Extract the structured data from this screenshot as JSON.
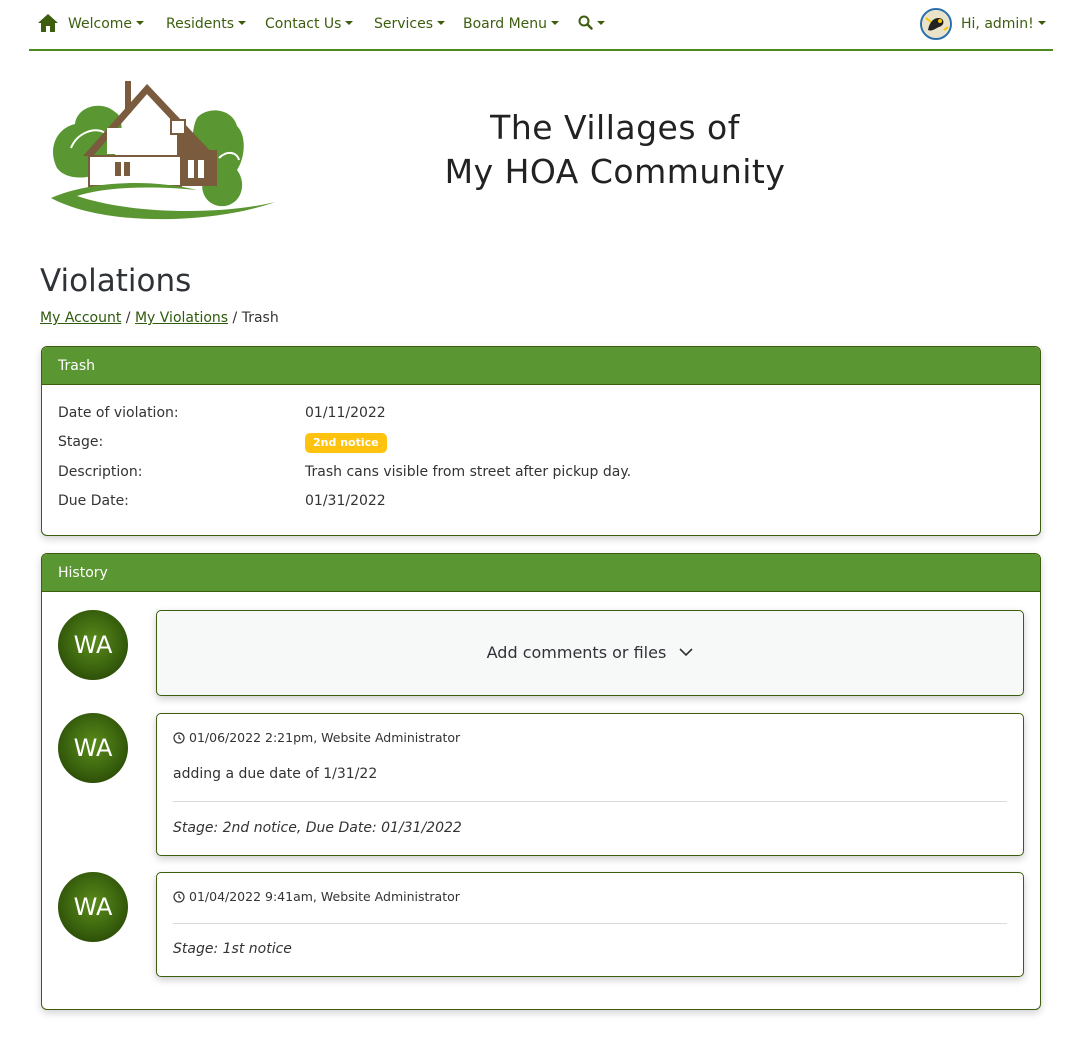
{
  "nav": {
    "items": [
      {
        "label": "Welcome"
      },
      {
        "label": "Residents"
      },
      {
        "label": "Contact Us"
      },
      {
        "label": "Services"
      },
      {
        "label": "Board Menu"
      }
    ],
    "user_greeting": "Hi, admin!"
  },
  "header": {
    "title_line1": "The Villages of",
    "title_line2": "My HOA Community"
  },
  "page": {
    "title": "Violations",
    "breadcrumb": {
      "link1": "My Account",
      "sep1": "/",
      "link2": "My Violations",
      "sep2": "/",
      "current": "Trash"
    }
  },
  "violation": {
    "header": "Trash",
    "rows": [
      {
        "label": "Date of violation:",
        "value": "01/11/2022"
      },
      {
        "label": "Stage:",
        "value": "2nd notice"
      },
      {
        "label": "Description:",
        "value": "Trash cans visible from street after pickup day."
      },
      {
        "label": "Due Date:",
        "value": "01/31/2022"
      }
    ],
    "badge_color": "#ffc20e"
  },
  "history": {
    "header": "History",
    "add_label": "Add comments or files",
    "avatar_initials": "WA",
    "entries": [
      {
        "meta": "01/06/2022 2:21pm, Website Administrator",
        "text": "adding a due date of 1/31/22",
        "status": "Stage: 2nd notice, Due Date: 01/31/2022"
      },
      {
        "meta": "01/04/2022 9:41am, Website Administrator",
        "status": "Stage: 1st notice"
      }
    ]
  },
  "colors": {
    "brand_green": "#5a9631",
    "nav_text": "#3c5e0e",
    "link": "#2e5a0c"
  },
  "icons": [
    "home-icon",
    "search-icon",
    "clock-icon",
    "chevron-down-icon"
  ]
}
